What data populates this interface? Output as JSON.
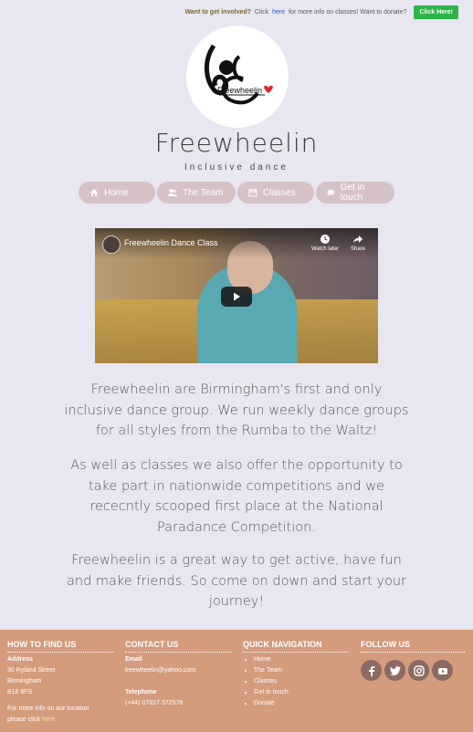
{
  "topbar": {
    "involved_label": "Want to get involved?",
    "text1": "Click",
    "here_link": "here",
    "text2": "for more info on classes! Want to donate?",
    "button_label": "Click Here!"
  },
  "logo": {
    "icon_name": "freewheelin-logo",
    "text": "Freewheelin"
  },
  "header": {
    "title": "Freewheelin",
    "subtitle": "Inclusive dance"
  },
  "nav": [
    {
      "label": "Home",
      "icon": "home-icon"
    },
    {
      "label": "The Team",
      "icon": "users-icon"
    },
    {
      "label": "Classes",
      "icon": "calendar-icon"
    },
    {
      "label": "Get in touch",
      "icon": "chat-icon"
    }
  ],
  "video": {
    "title": "Freewheelin Dance Class",
    "watch_later": "Watch later",
    "share": "Share"
  },
  "content": {
    "p1": "Freewheelin are Birmingham's first and only inclusive dance group. We run weekly dance groups for all styles from the Rumba to the Waltz!",
    "p2": "As well as classes we also offer the opportunity to take part in nationwide competitions and we rececntly scooped first place at the National Paradance Competition.",
    "p3": "Freewheelin is a great way to get active, have fun and make friends. So come on down and start your journey!"
  },
  "footer": {
    "find": {
      "heading": "HOW TO FIND US",
      "address_label": "Address",
      "line1": "30 Ryland Street",
      "line2": "Birmingham",
      "line3": "B16 8FS",
      "more1": "For more info on our location",
      "more2": "please click",
      "here": "here"
    },
    "contact": {
      "heading": "CONTACT US",
      "email_label": "Email",
      "email": "freewheelin@yahoo.com",
      "phone_label": "Telephone",
      "phone": "(+44) 07817 372578"
    },
    "quicknav": {
      "heading": "QUICK NAVIGATION",
      "items": [
        "Home",
        "The Team",
        "Classes",
        "Get in touch",
        "Donate"
      ]
    },
    "follow": {
      "heading": "FOLLOW US",
      "icons": [
        "facebook-icon",
        "twitter-icon",
        "instagram-icon",
        "youtube-icon"
      ]
    }
  },
  "colors": {
    "background": "#e8e6f0",
    "nav_pill": "#d5c2c6",
    "footer": "#d49b7c",
    "cta_green": "#2db34a"
  }
}
